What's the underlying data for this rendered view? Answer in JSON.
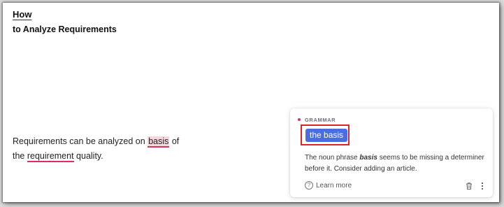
{
  "document": {
    "title_line_1": "How",
    "title_line_2": "to Analyze Requirements",
    "paragraph": {
      "line1_prefix": "Requirements can be analyzed on ",
      "flagged_word_1": "basis",
      "line1_suffix": " of",
      "line2_prefix": "the ",
      "flagged_word_2": "requirement",
      "line2_suffix": " quality."
    }
  },
  "suggestion_card": {
    "category": "GRAMMAR",
    "suggestion": "the basis",
    "explanation_prefix": "The noun phrase ",
    "explanation_emphasis": "basis",
    "explanation_suffix": " seems to be missing a determiner before it. Consider adding an article.",
    "learn_more_label": "Learn more",
    "learn_more_icon": "question-circle-icon",
    "delete_icon": "trash-icon",
    "more_icon": "vertical-dots-icon"
  },
  "colors": {
    "accent_blue": "#4a6ee0",
    "error_red": "#d9315a",
    "highlight_box_red": "#e02424",
    "flag_background": "#f7d7de"
  }
}
